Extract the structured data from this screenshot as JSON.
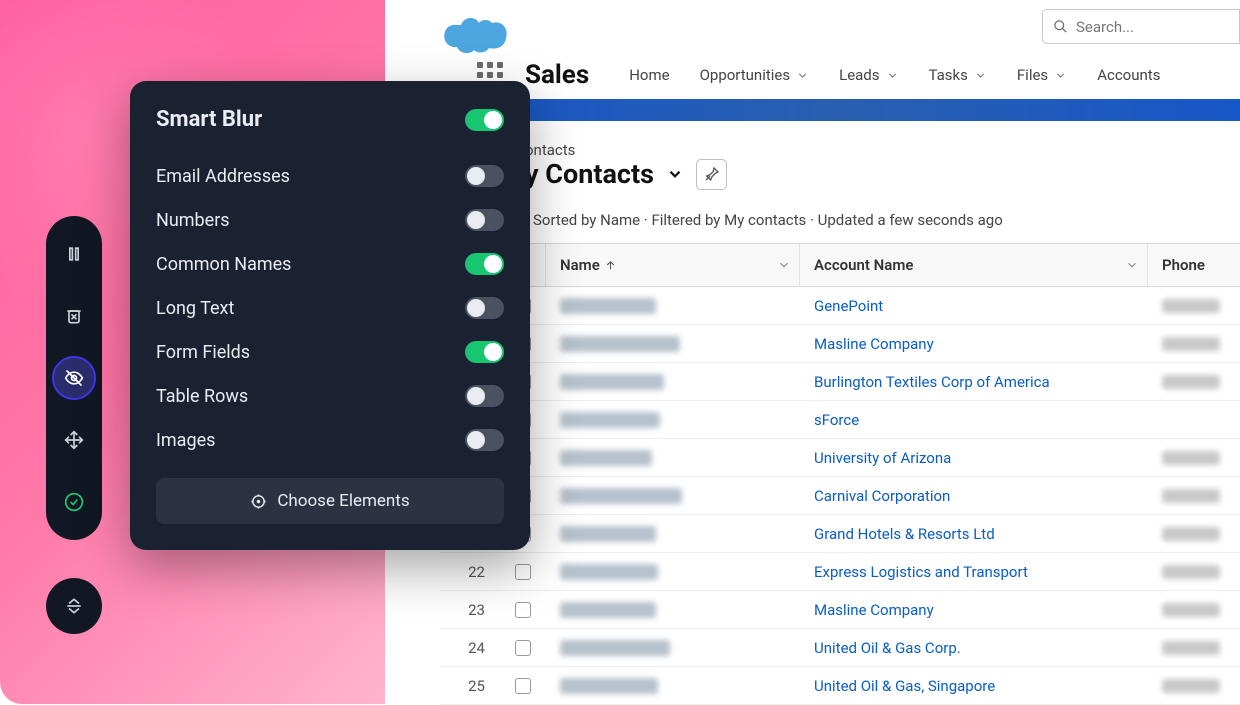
{
  "panel": {
    "title": "Smart Blur",
    "master_on": true,
    "options": [
      {
        "label": "Email Addresses",
        "on": false
      },
      {
        "label": "Numbers",
        "on": false
      },
      {
        "label": "Common Names",
        "on": true
      },
      {
        "label": "Long Text",
        "on": false
      },
      {
        "label": "Form Fields",
        "on": true
      },
      {
        "label": "Table Rows",
        "on": false
      },
      {
        "label": "Images",
        "on": false
      }
    ],
    "choose_label": "Choose Elements"
  },
  "search": {
    "placeholder": "Search..."
  },
  "app": {
    "name": "Sales"
  },
  "nav": [
    "Home",
    "Opportunities",
    "Leads",
    "Tasks",
    "Files",
    "Accounts"
  ],
  "section": {
    "subtitle": "ontacts",
    "title": "y Contacts",
    "meta": "Sorted by Name · Filtered by My contacts · Updated a few seconds ago"
  },
  "columns": {
    "name": "Name",
    "account": "Account Name",
    "phone": "Phone"
  },
  "rows": [
    {
      "num": "",
      "blurw": 96,
      "account": "GenePoint",
      "phone": true
    },
    {
      "num": "",
      "blurw": 120,
      "account": "Masline Company",
      "phone": true
    },
    {
      "num": "",
      "blurw": 104,
      "account": "Burlington Textiles Corp of America",
      "phone": true
    },
    {
      "num": "",
      "blurw": 100,
      "account": "sForce",
      "phone": false
    },
    {
      "num": "",
      "blurw": 92,
      "account": "University of Arizona",
      "phone": true
    },
    {
      "num": "",
      "blurw": 122,
      "account": "Carnival Corporation",
      "phone": true
    },
    {
      "num": "",
      "blurw": 96,
      "account": "Grand Hotels & Resorts Ltd",
      "phone": true
    },
    {
      "num": "22",
      "blurw": 98,
      "account": "Express Logistics and Transport",
      "phone": true
    },
    {
      "num": "23",
      "blurw": 96,
      "account": "Masline Company",
      "phone": true
    },
    {
      "num": "24",
      "blurw": 110,
      "account": "United Oil & Gas Corp.",
      "phone": true
    },
    {
      "num": "25",
      "blurw": 98,
      "account": "United Oil & Gas, Singapore",
      "phone": true
    }
  ]
}
